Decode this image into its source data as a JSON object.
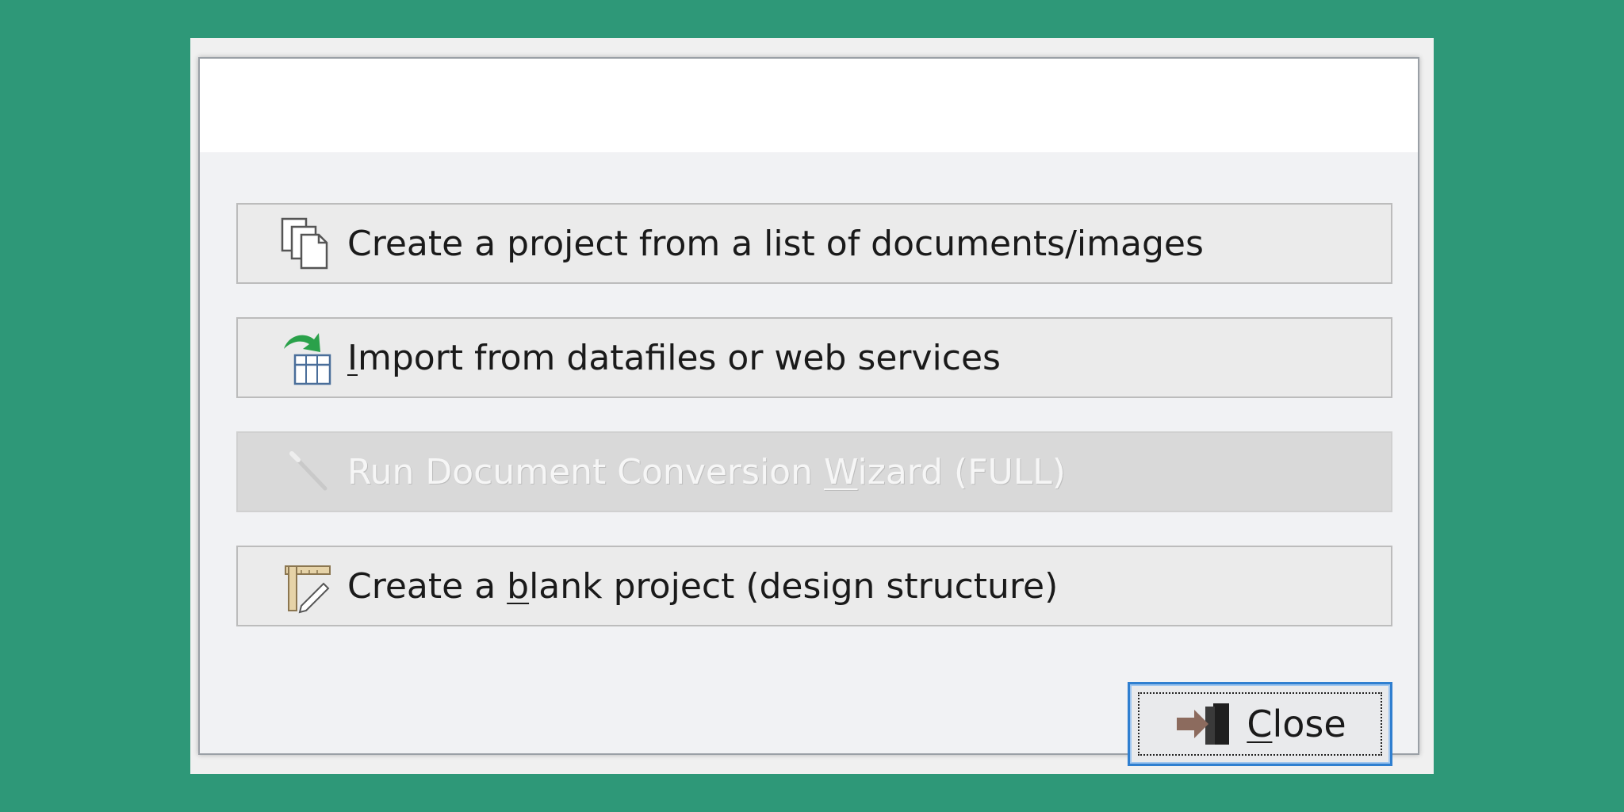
{
  "options": [
    {
      "pre": "Create a project from a list of documents/images",
      "u": "",
      "post": "",
      "icon": "documents-icon",
      "enabled": true
    },
    {
      "pre": "",
      "u": "I",
      "post": "mport from datafiles or web services",
      "icon": "import-data-icon",
      "enabled": true
    },
    {
      "pre": "Run Document Conversion ",
      "u": "W",
      "post": "izard (FULL)",
      "icon": "wand-icon",
      "enabled": false
    },
    {
      "pre": "Create a ",
      "u": "b",
      "post": "lank project (design structure)",
      "icon": "design-structure-icon",
      "enabled": true
    }
  ],
  "close": {
    "u": "C",
    "rest": "lose",
    "icon": "exit-door-icon"
  },
  "colors": {
    "background": "#2e9878",
    "focus_border": "#2f7fd0",
    "arrow_green": "#2aa14a"
  }
}
